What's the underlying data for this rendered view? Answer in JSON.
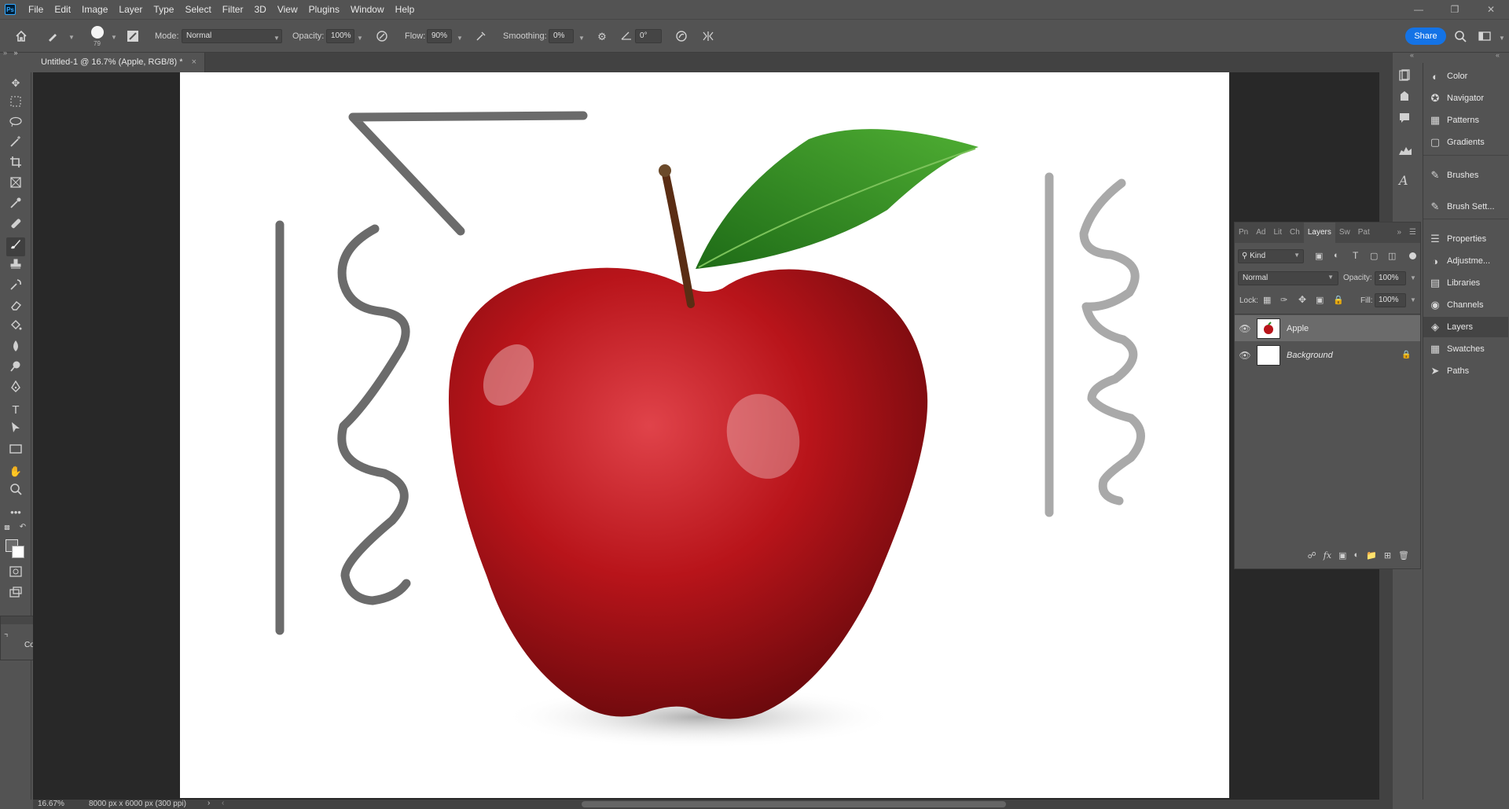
{
  "app": {
    "logo_text": "Ps"
  },
  "menu": [
    "File",
    "Edit",
    "Image",
    "Layer",
    "Type",
    "Select",
    "Filter",
    "3D",
    "View",
    "Plugins",
    "Window",
    "Help"
  ],
  "options_bar": {
    "brush_size": "79",
    "mode_label": "Mode:",
    "mode_value": "Normal",
    "opacity_label": "Opacity:",
    "opacity_value": "100%",
    "flow_label": "Flow:",
    "flow_value": "90%",
    "smoothing_label": "Smoothing:",
    "smoothing_value": "0%",
    "angle_value": "0°",
    "share_label": "Share"
  },
  "document": {
    "tab_title": "Untitled-1 @ 16.7% (Apple, RGB/8) *",
    "close_glyph": "×"
  },
  "floating_panel": {
    "label": "Conce..."
  },
  "layers_panel": {
    "tabs": [
      "Pn",
      "Ad",
      "Lit",
      "Ch",
      "Layers",
      "Sw",
      "Pat"
    ],
    "active_tab": "Layers",
    "filter_kind": "Kind",
    "blend_mode": "Normal",
    "opacity_label": "Opacity:",
    "opacity_value": "100%",
    "lock_label": "Lock:",
    "fill_label": "Fill:",
    "fill_value": "100%",
    "layers": [
      {
        "name": "Apple",
        "selected": true,
        "locked": false
      },
      {
        "name": "Background",
        "selected": false,
        "locked": true
      }
    ]
  },
  "dock": [
    {
      "label": "Color",
      "icon": "color-icon"
    },
    {
      "label": "Navigator",
      "icon": "navigator-icon"
    },
    {
      "label": "Patterns",
      "icon": "patterns-icon"
    },
    {
      "label": "Gradients",
      "icon": "gradients-icon"
    },
    {
      "label": "Brushes",
      "icon": "brushes-icon"
    },
    {
      "label": "Brush Sett...",
      "icon": "brush-settings-icon"
    },
    {
      "label": "Properties",
      "icon": "properties-icon"
    },
    {
      "label": "Adjustme...",
      "icon": "adjustments-icon"
    },
    {
      "label": "Libraries",
      "icon": "libraries-icon"
    },
    {
      "label": "Channels",
      "icon": "channels-icon"
    },
    {
      "label": "Layers",
      "icon": "layers-icon"
    },
    {
      "label": "Swatches",
      "icon": "swatches-icon"
    },
    {
      "label": "Paths",
      "icon": "paths-icon"
    }
  ],
  "status": {
    "zoom": "16.67%",
    "doc_info": "8000 px x 6000 px (300 ppi)"
  },
  "colors": {
    "accent": "#1473e6",
    "foreground_swatch": "#6b6b6b",
    "background_swatch": "#ffffff",
    "apple_red": "#b8141a",
    "leaf_green": "#2f8a24"
  }
}
